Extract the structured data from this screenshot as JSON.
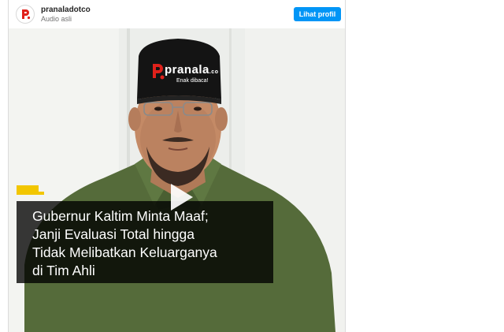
{
  "header": {
    "username": "pranaladotco",
    "audio_label": "Audio asli",
    "profile_button": "Lihat profil"
  },
  "watermark": {
    "brand": "pranala",
    "tld": ".co",
    "tagline": "Enak dibaca!"
  },
  "caption": {
    "lines": [
      "Gubernur Kaltim Minta Maaf;",
      "Janji Evaluasi Total hingga",
      "Tidak Melibatkan Keluarganya",
      "di Tim Ahli"
    ]
  },
  "colors": {
    "accent": "#0095f6",
    "brand_red": "#e0211b",
    "caption_accent": "#f2c600"
  },
  "icons": {
    "avatar": "pranala-logo-icon",
    "play": "play-icon"
  }
}
